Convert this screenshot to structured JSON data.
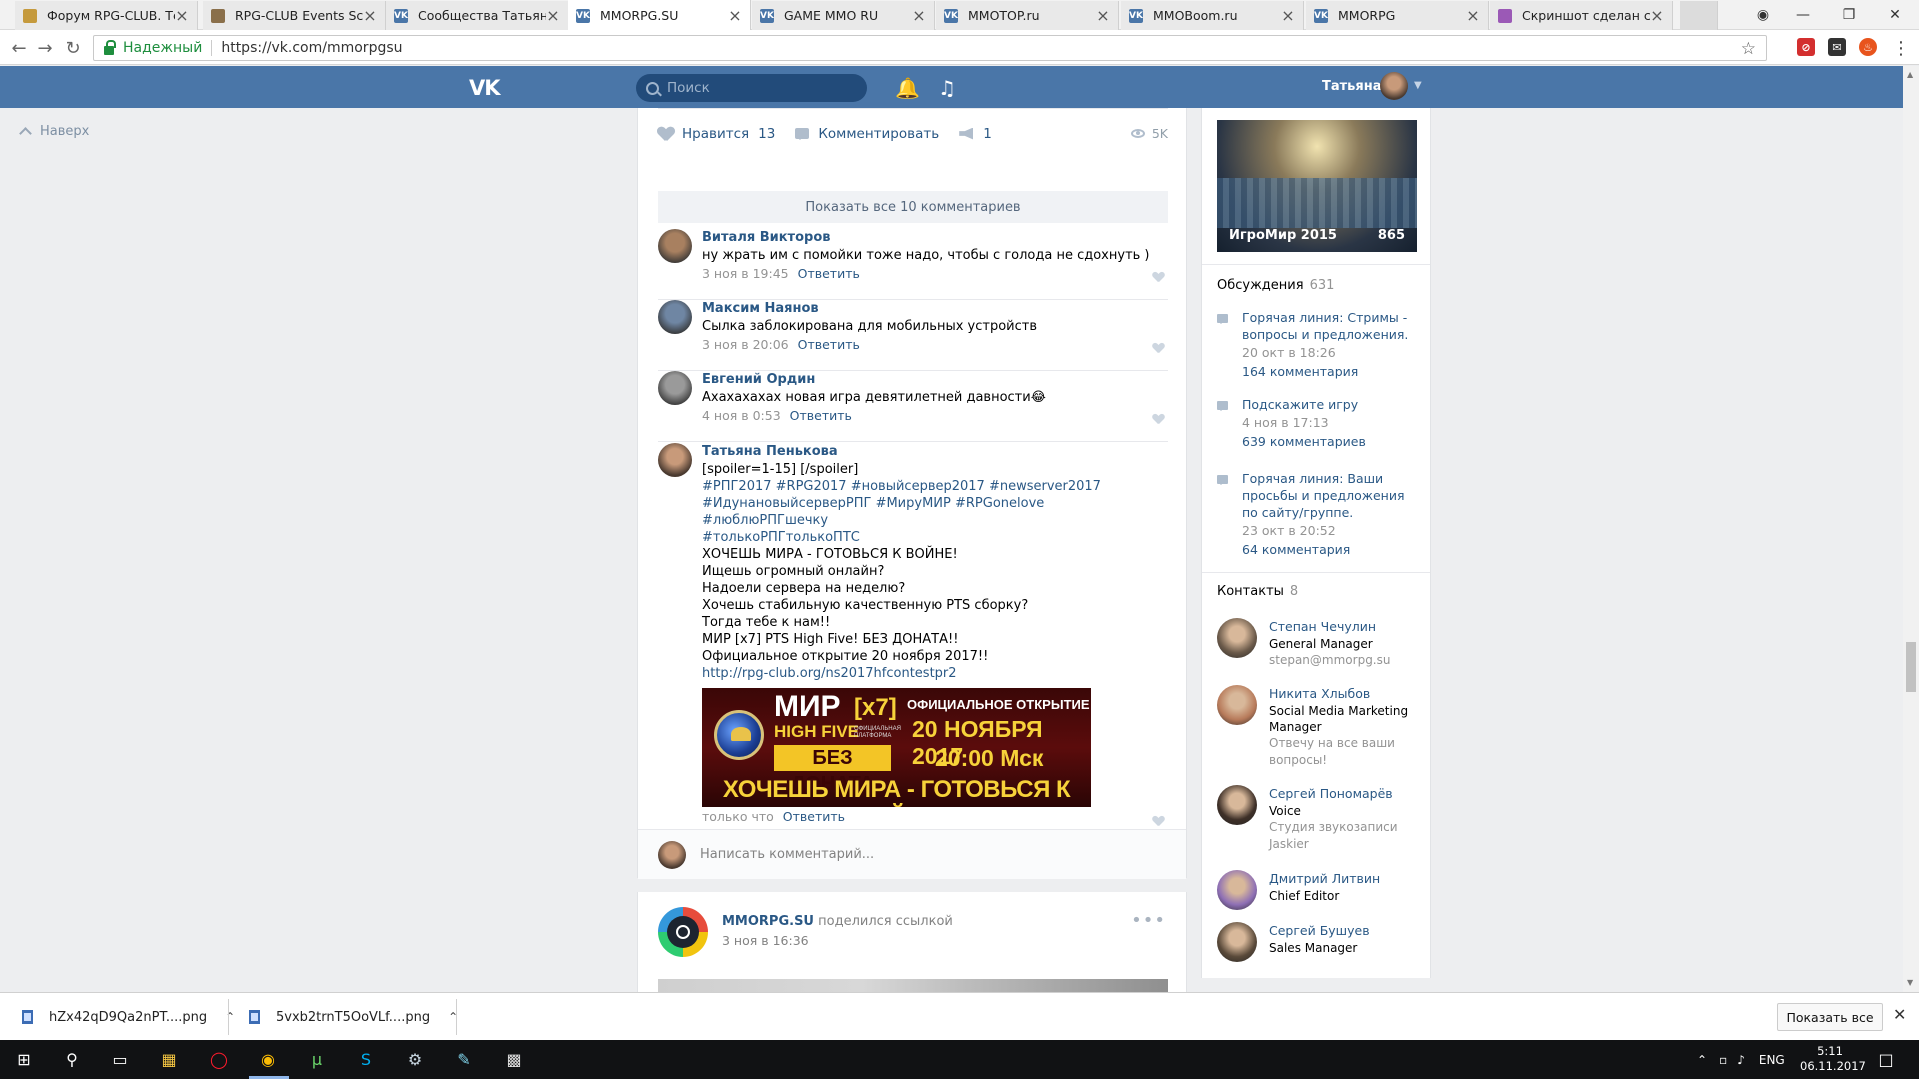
{
  "browser": {
    "tabs": [
      {
        "label": "Форум RPG-CLUB. Тем",
        "color": "#c59a3d",
        "glyph": "",
        "active": false
      },
      {
        "label": "RPG-CLUB Events Scre",
        "color": "#8a6f4a",
        "glyph": "",
        "active": false
      },
      {
        "label": "Сообщества Татьяны П",
        "color": "#4a76a8",
        "glyph": "VK",
        "active": false
      },
      {
        "label": "MMORPG.SU",
        "color": "#4a76a8",
        "glyph": "VK",
        "active": true
      },
      {
        "label": "GAME MMO RU",
        "color": "#4a76a8",
        "glyph": "VK",
        "active": false
      },
      {
        "label": "MMOTOP.ru",
        "color": "#4a76a8",
        "glyph": "VK",
        "active": false
      },
      {
        "label": "MMOBoom.ru",
        "color": "#4a76a8",
        "glyph": "VK",
        "active": false
      },
      {
        "label": "MMORPG",
        "color": "#4a76a8",
        "glyph": "VK",
        "active": false
      },
      {
        "label": "Скриншот сделан с по",
        "color": "#9b59b6",
        "glyph": "",
        "active": false
      }
    ],
    "secure_label": "Надежный",
    "url": "https://vk.com/mmorpgsu"
  },
  "vk_header": {
    "logo": "VK",
    "search_placeholder": "Поиск",
    "user_name": "Татьяна"
  },
  "left": {
    "to_top": "Наверх"
  },
  "post": {
    "like_label": "Нравится",
    "like_count": "13",
    "comment_label": "Комментировать",
    "share_count": "1",
    "views": "5K",
    "show_all_comments": "Показать все 10 комментариев"
  },
  "comments": [
    {
      "name": "Виталя Викторов",
      "text": "ну жрать им с помойки тоже надо, чтобы с голода не сдохнуть )",
      "time": "3 ноя в 19:45",
      "reply": "Ответить",
      "avatar": "#a88060"
    },
    {
      "name": "Максим Наянов",
      "text": "Сылка заблокирована для мобильных устройств",
      "time": "3 ноя в 20:06",
      "reply": "Ответить",
      "avatar": "#6f86a3"
    },
    {
      "name": "Евгений Ордин",
      "text": "Ахахахахах новая игра девятилетней давности😂",
      "time": "4 ноя в 0:53",
      "reply": "Ответить",
      "avatar": "#9a9a9a"
    }
  ],
  "main_comment": {
    "name": "Татьяна Пенькова",
    "lines": [
      "[spoiler=1-15] [/spoiler]",
      "#РПГ2017 #RPG2017 #новыйсервер2017 #newserver2017",
      "#ИдунановыйсерверРПГ #МируМИР #RPGonelove #люблюРПГшечку",
      "#толькоРПГтолькоПТС",
      "ХОЧЕШЬ МИРА - ГОТОВЬСЯ К ВОЙНЕ!",
      "Ищешь огромный онлайн?",
      "Надоели сервера на неделю?",
      "Хочешь стабильную качественную PTS сборку?",
      "Тогда тебе к нам!!",
      "МИР [x7] PTS High Five! БЕЗ ДОНАТА!!",
      "Официальное открытие 20 ноября 2017!!",
      "http://rpg-club.org/ns2017hfcontestpr2"
    ],
    "time": "только что",
    "reply": "Ответить",
    "banner": {
      "mir": "МИР",
      "x7": "[x7]",
      "high_five": "HIGH FIVE",
      "platform": "ОФИЦИАЛЬНАЯ ПЛАТФОРМА",
      "no_donate": "БЕЗ ДОНАТА",
      "opening": "ОФИЦИАЛЬНОЕ ОТКРЫТИЕ",
      "date": "20 НОЯБРЯ 2017",
      "time": "20:00 Мск",
      "war": "ХОЧЕШЬ МИРА - ГОТОВЬСЯ К ВОЙНЕ"
    }
  },
  "write_comment_placeholder": "Написать комментарий...",
  "next_post": {
    "author": "MMORPG.SU",
    "action": "поделился ссылкой",
    "date": "3 ноя в 16:36"
  },
  "sidebar": {
    "album": {
      "title": "ИгроМир 2015",
      "count": "865"
    },
    "discussions": {
      "title": "Обсуждения",
      "count": "631",
      "items": [
        {
          "title": "Горячая линия: Стримы - вопросы и предложения.",
          "date": "20 окт в 18:26",
          "comments": "164 комментария"
        },
        {
          "title": "Подскажите игру",
          "date": "4 ноя в 17:13",
          "comments": "639 комментариев"
        },
        {
          "title": "Горячая линия: Ваши просьбы и предложения по сайту/группе.",
          "date": "23 окт в 20:52",
          "comments": "64 комментария"
        }
      ]
    },
    "contacts": {
      "title": "Контакты",
      "count": "8",
      "items": [
        {
          "name": "Степан Чечулин",
          "role": "General Manager",
          "extra": "stepan@mmorpg.su",
          "color": "#6b5a4a"
        },
        {
          "name": "Никита Хлыбов",
          "role": "Social Media Marketing Manager",
          "extra": "Отвечу на все ваши вопросы!",
          "color": "#b77a5a"
        },
        {
          "name": "Сергей Пономарёв",
          "role": "Voice",
          "extra": "Студия звукозаписи Jaskier",
          "color": "#3e3028"
        },
        {
          "name": "Дмитрий Литвин",
          "role": "Chief Editor",
          "extra": "",
          "color": "#8e6fb5"
        },
        {
          "name": "Сергей Бушуев",
          "role": "Sales Manager",
          "extra": "",
          "color": "#5a4a3a"
        }
      ]
    }
  },
  "downloads": {
    "files": [
      "hZx42qD9Qa2nPT....png",
      "5vxb2trnT5OoVLf....png"
    ],
    "show_all": "Показать все"
  },
  "taskbar": {
    "lang": "ENG",
    "time": "5:11",
    "date": "06.11.2017"
  }
}
